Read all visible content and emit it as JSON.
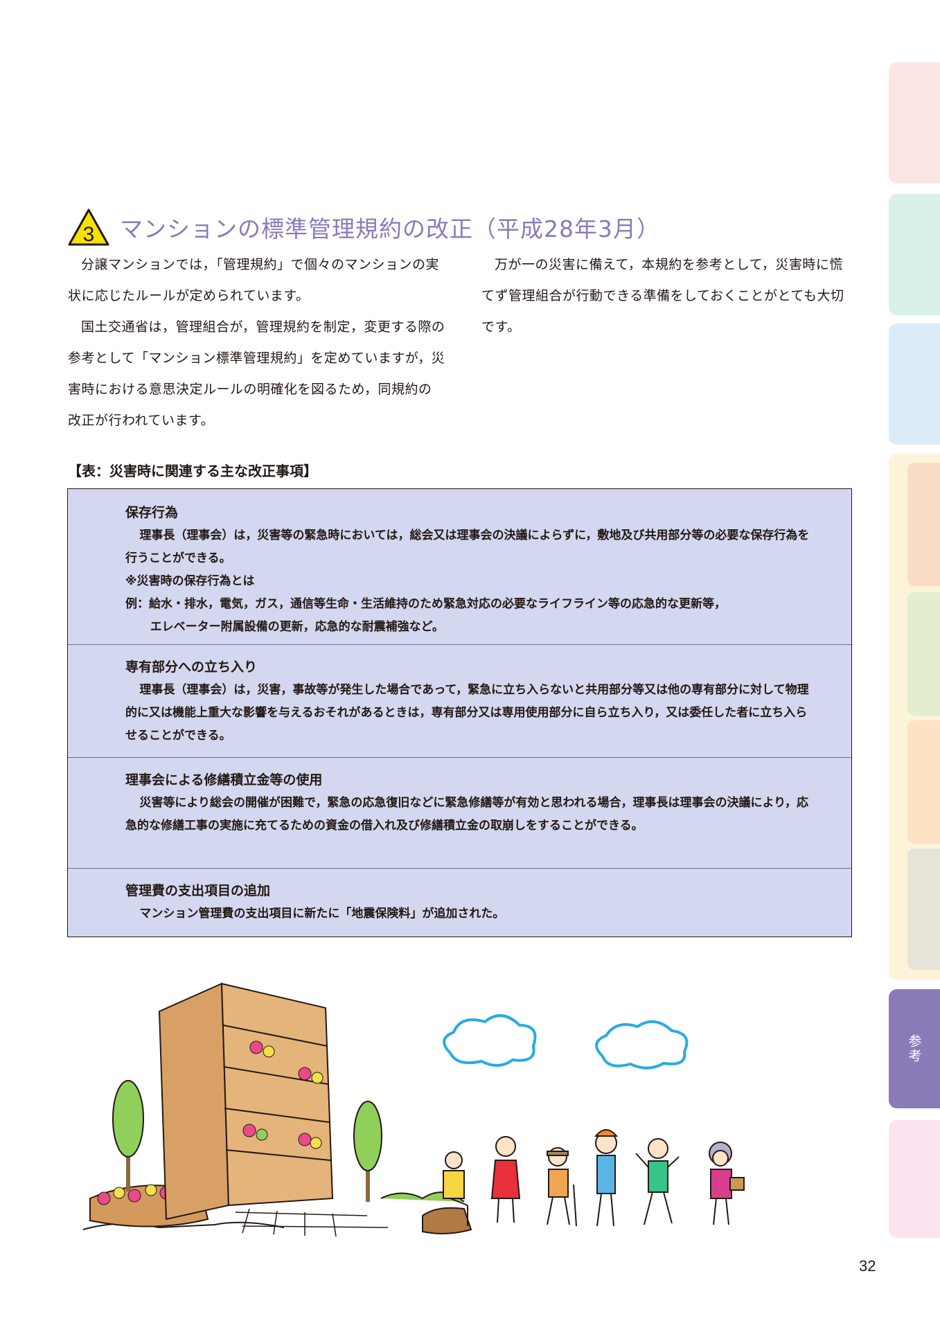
{
  "section": {
    "number": "3",
    "title": "マンションの標準管理規約の改正（平成28年3月）"
  },
  "intro_left": [
    "分譲マンションでは，「管理規約」で個々のマンションの実状に応じたルールが定められています。",
    "国土交通省は，管理組合が，管理規約を制定，変更する際の参考として「マンション標準管理規約」を定めていますが，災害時における意思決定ルールの明確化を図るため，同規約の改正が行われています。"
  ],
  "intro_right": [
    "万が一の災害に備えて，本規約を参考として，災害時に慌てず管理組合が行動できる準備をしておくことがとても大切です。"
  ],
  "table_caption": "【表：災害時に関連する主な改正事項】",
  "revisions": [
    {
      "title": "保存行為",
      "body": "理事長（理事会）は，災害等の緊急時においては，総会又は理事会の決議によらずに，敷地及び共用部分等の必要な保存行為を行うことができる。",
      "note_title": "※災害時の保存行為とは",
      "note_example": "例：給水・排水，電気，ガス，通信等生命・生活維持のため緊急対応の必要なライフライン等の応急的な更新等，",
      "note_example_cont": "エレベーター附属設備の更新，応急的な耐震補強など。"
    },
    {
      "title": "専有部分への立ち入り",
      "body": "理事長（理事会）は，災害，事故等が発生した場合であって，緊急に立ち入らないと共用部分等又は他の専有部分に対して物理的に又は機能上重大な影響を与えるおそれがあるときは，専有部分又は専用使用部分に自ら立ち入り，又は委任した者に立ち入らせることができる。"
    },
    {
      "title": "理事会による修繕積立金等の使用",
      "body": "災害等により総会の開催が困難で，緊急の応急復旧などに緊急修繕等が有効と思われる場合，理事長は理事会の決議により，応急的な修繕工事の実施に充てるための資金の借入れ及び修繕積立金の取崩しをすることができる。"
    },
    {
      "title": "管理費の支出項目の追加",
      "body": "マンション管理費の支出項目に新たに「地震保険料」が追加された。"
    }
  ],
  "side_tab_active": "参考",
  "page_number": "32",
  "colors": {
    "accent": "#8b7ab8",
    "table_bg": "#d3d7ef",
    "warning_yellow": "#f6e100"
  }
}
